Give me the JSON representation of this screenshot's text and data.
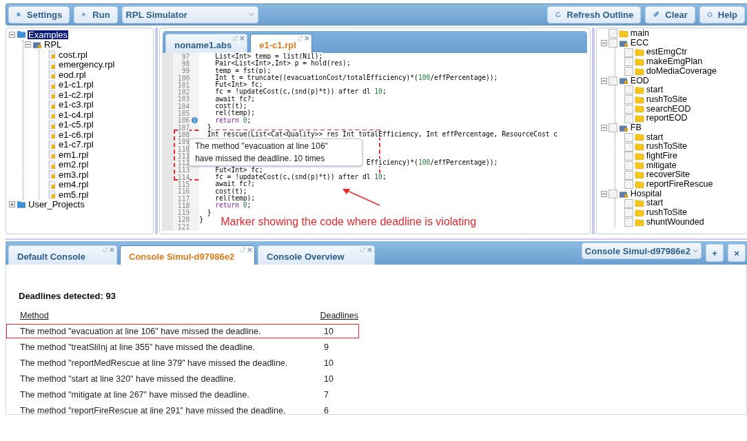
{
  "toolbar": {
    "left": [
      {
        "label": "Settings",
        "kind": "settings"
      },
      {
        "label": "Run",
        "kind": "run"
      }
    ],
    "simulator_select": {
      "value": "RPL Simulator"
    },
    "right": [
      {
        "label": "Refresh Outline",
        "kind": "refresh"
      },
      {
        "label": "Clear",
        "kind": "clear"
      },
      {
        "label": "Help",
        "kind": "help"
      }
    ]
  },
  "project_tree": [
    {
      "label": "Examples",
      "kind": "project",
      "selected": true,
      "expanded": true,
      "children": [
        {
          "label": "RPL",
          "kind": "folder",
          "selected": false,
          "expanded": true,
          "children": [
            {
              "label": "cost.rpl",
              "kind": "file",
              "selected": false
            },
            {
              "label": "emergency.rpl",
              "kind": "file",
              "selected": false
            },
            {
              "label": "eod.rpl",
              "kind": "file",
              "selected": false
            },
            {
              "label": "e1-c1.rpl",
              "kind": "file",
              "selected": false
            },
            {
              "label": "e1-c2.rpl",
              "kind": "file",
              "selected": false
            },
            {
              "label": "e1-c3.rpl",
              "kind": "file",
              "selected": false
            },
            {
              "label": "e1-c4.rpl",
              "kind": "file",
              "selected": false
            },
            {
              "label": "e1-c5.rpl",
              "kind": "file",
              "selected": false
            },
            {
              "label": "e1-c6.rpl",
              "kind": "file",
              "selected": false
            },
            {
              "label": "e1-c7.rpl",
              "kind": "file",
              "selected": false
            },
            {
              "label": "em1.rpl",
              "kind": "file",
              "selected": false
            },
            {
              "label": "em2.rpl",
              "kind": "file",
              "selected": false
            },
            {
              "label": "em3.rpl",
              "kind": "file",
              "selected": false
            },
            {
              "label": "em4.rpl",
              "kind": "file",
              "selected": false
            },
            {
              "label": "em5.rpl",
              "kind": "file",
              "selected": false
            }
          ]
        }
      ]
    },
    {
      "label": "User_Projects",
      "kind": "project",
      "selected": false,
      "expanded": false
    }
  ],
  "editor": {
    "tabs": [
      {
        "label": "noname1.abs",
        "selected": false
      },
      {
        "label": "e1-c1.rpl",
        "selected": true
      }
    ],
    "lines": [
      {
        "n": "97",
        "code": [
          {
            "text": "    List<Int> temp = list(Nil);",
            "kind": "plain"
          }
        ]
      },
      {
        "n": "98",
        "code": [
          {
            "text": "    Pair<List<Int>,Int> p = hold(res);",
            "kind": "plain"
          }
        ]
      },
      {
        "n": "99",
        "code": [
          {
            "text": "    temp = fst(p);",
            "kind": "plain"
          }
        ]
      },
      {
        "n": "100",
        "code": [
          {
            "text": "    Int t = truncate((evacuationCost/totalEfficiency)*(",
            "kind": "plain"
          },
          {
            "text": "100",
            "kind": "number"
          },
          {
            "text": "/effPercentage));",
            "kind": "plain"
          }
        ]
      },
      {
        "n": "101",
        "code": [
          {
            "text": "    Fut<Int> fc;",
            "kind": "plain"
          }
        ]
      },
      {
        "n": "102",
        "code": [
          {
            "text": "    fc = !updateCost(c,(snd(p)*t)) after dl ",
            "kind": "plain"
          },
          {
            "text": "10",
            "kind": "number"
          },
          {
            "text": ";",
            "kind": "plain"
          }
        ]
      },
      {
        "n": "103",
        "code": [
          {
            "text": "    await fc?;",
            "kind": "plain"
          }
        ]
      },
      {
        "n": "104",
        "code": [
          {
            "text": "    cost(t);",
            "kind": "plain"
          }
        ]
      },
      {
        "n": "105",
        "code": [
          {
            "text": "    rel(temp);",
            "kind": "plain"
          }
        ]
      },
      {
        "n": "106",
        "marker": true,
        "code": [
          {
            "text": "    return",
            "kind": "keyword"
          },
          {
            "text": " 0",
            "kind": "number"
          },
          {
            "text": ";",
            "kind": "plain"
          }
        ]
      },
      {
        "n": "107",
        "code": [
          {
            "text": "  }",
            "kind": "plain"
          }
        ]
      },
      {
        "n": "108",
        "code": [
          {
            "text": "  Int rescue(List<Cat<Quality>> res Int totalEfficiency, Int effPercentage, ResourceCost c",
            "kind": "plain"
          }
        ]
      },
      {
        "n": "109"
      },
      {
        "n": "110"
      },
      {
        "n": "111"
      },
      {
        "n": "112",
        "code": [
          {
            "text": "                                          Efficiency)*(",
            "kind": "plain"
          },
          {
            "text": "100",
            "kind": "number"
          },
          {
            "text": "/effPercentage));",
            "kind": "plain"
          }
        ]
      },
      {
        "n": "113",
        "code": [
          {
            "text": "    Fut<Int> fc;",
            "kind": "plain"
          }
        ]
      },
      {
        "n": "114",
        "code": [
          {
            "text": "    fc = !updateCost(c,(snd(p)*t)) after dl ",
            "kind": "plain"
          },
          {
            "text": "10",
            "kind": "number"
          },
          {
            "text": ";",
            "kind": "plain"
          }
        ]
      },
      {
        "n": "115",
        "code": [
          {
            "text": "    await fc?;",
            "kind": "plain"
          }
        ]
      },
      {
        "n": "116",
        "code": [
          {
            "text": "    cost(t);",
            "kind": "plain"
          }
        ]
      },
      {
        "n": "117",
        "code": [
          {
            "text": "    rel(temp);",
            "kind": "plain"
          }
        ]
      },
      {
        "n": "118",
        "code": [
          {
            "text": "    return",
            "kind": "keyword"
          },
          {
            "text": " 0",
            "kind": "number"
          },
          {
            "text": ";",
            "kind": "plain"
          }
        ]
      },
      {
        "n": "119",
        "code": [
          {
            "text": "  }",
            "kind": "plain"
          }
        ]
      },
      {
        "n": "120",
        "code": [
          {
            "text": "}",
            "kind": "plain"
          }
        ]
      },
      {
        "n": "121"
      }
    ],
    "tooltip": {
      "lines": [
        "The method \"evacuation at line 106\"",
        "have missed the deadline. 10 times"
      ]
    },
    "annotation": "Marker showing the code where deadline is violating"
  },
  "outline": [
    {
      "label": "main",
      "kind": "method",
      "checked": false
    },
    {
      "label": "ECC",
      "kind": "class",
      "checked": false,
      "expanded": true,
      "children": [
        {
          "label": "estEmgCtr",
          "kind": "method",
          "checked": false
        },
        {
          "label": "makeEmgPlan",
          "kind": "method",
          "checked": false
        },
        {
          "label": "doMediaCoverage",
          "kind": "method",
          "checked": false
        }
      ]
    },
    {
      "label": "EOD",
      "kind": "class",
      "checked": false,
      "expanded": true,
      "children": [
        {
          "label": "start",
          "kind": "method",
          "checked": false
        },
        {
          "label": "rushToSite",
          "kind": "method",
          "checked": false
        },
        {
          "label": "searchEOD",
          "kind": "method",
          "checked": false
        },
        {
          "label": "reportEOD",
          "kind": "method",
          "checked": false
        }
      ]
    },
    {
      "label": "FB",
      "kind": "class",
      "checked": false,
      "expanded": true,
      "children": [
        {
          "label": "start",
          "kind": "method",
          "checked": false
        },
        {
          "label": "rushToSite",
          "kind": "method",
          "checked": false
        },
        {
          "label": "fightFire",
          "kind": "method",
          "checked": false
        },
        {
          "label": "mitigate",
          "kind": "method",
          "checked": false
        },
        {
          "label": "recoverSite",
          "kind": "method",
          "checked": false
        },
        {
          "label": "reportFireRescue",
          "kind": "method",
          "checked": false
        }
      ]
    },
    {
      "label": "Hospital",
      "kind": "class",
      "checked": false,
      "expanded": true,
      "children": [
        {
          "label": "start",
          "kind": "method",
          "checked": false
        },
        {
          "label": "rushToSite",
          "kind": "method",
          "checked": false
        },
        {
          "label": "shuntWounded",
          "kind": "method",
          "checked": false
        }
      ]
    }
  ],
  "console": {
    "tabs": [
      {
        "label": "Default Console",
        "selected": false
      },
      {
        "label": "Console Simul-d97986e2",
        "selected": true
      },
      {
        "label": "Console Overview",
        "selected": false
      }
    ],
    "select": {
      "value": "Console Simul-d97986e2"
    },
    "buttons": [
      "+",
      "×"
    ],
    "summary": "Deadlines detected: 93",
    "columns": [
      "Method",
      "Deadlines"
    ],
    "rows": [
      {
        "method": "The method \"evacuation at line 106\" have missed the deadline.",
        "deadlines": "10",
        "highlighted": true
      },
      {
        "method": "The method \"treatSliInj at line 355\" have missed the deadline.",
        "deadlines": "9",
        "highlighted": false
      },
      {
        "method": "The method \"reportMedRescue at line 379\" have missed the deadline.",
        "deadlines": "10",
        "highlighted": false
      },
      {
        "method": "The method \"start at line 320\" have missed the deadline.",
        "deadlines": "10",
        "highlighted": false
      },
      {
        "method": "The method \"mitigate at line 267\" have missed the deadline.",
        "deadlines": "7",
        "highlighted": false
      },
      {
        "method": "The method \"reportFireRescue at line 291\" have missed the deadline.",
        "deadlines": "6",
        "highlighted": false
      }
    ]
  }
}
